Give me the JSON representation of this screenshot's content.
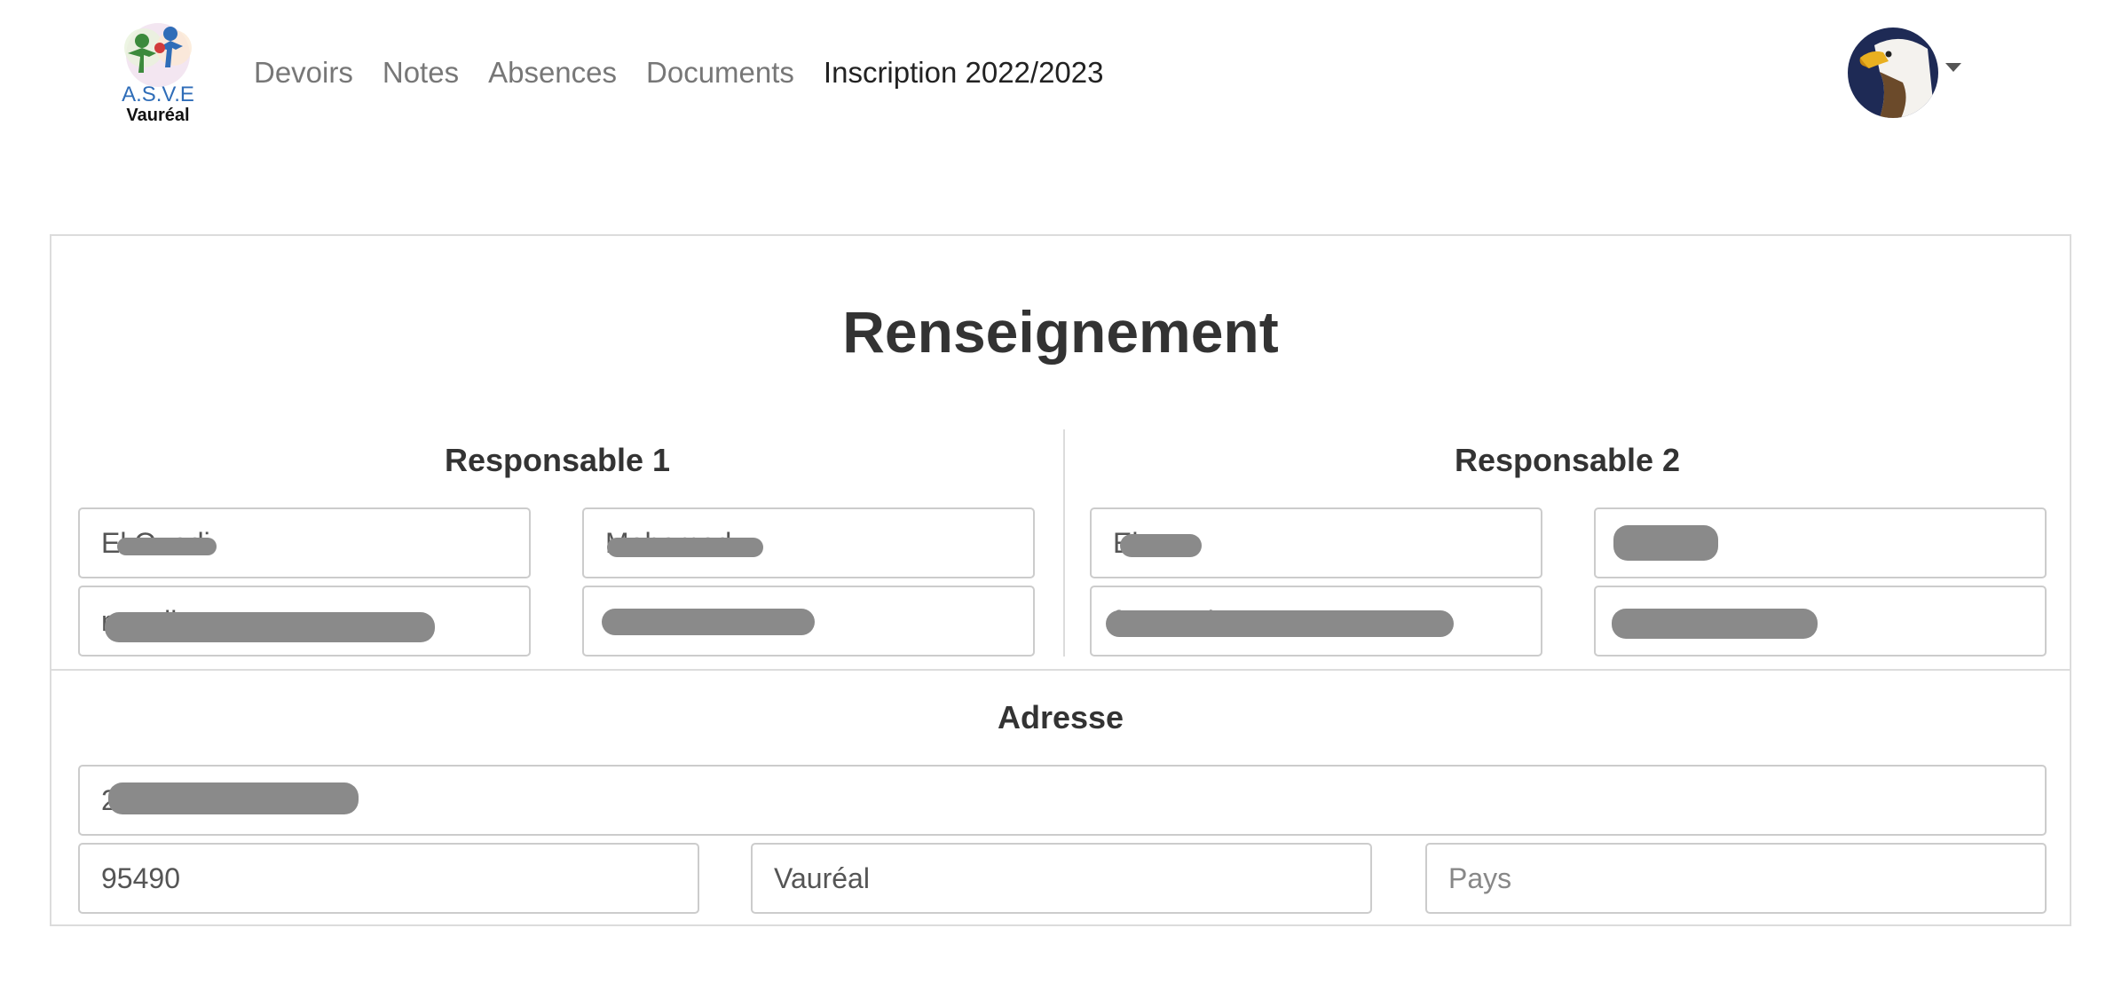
{
  "nav": {
    "items": [
      "Devoirs",
      "Notes",
      "Absences",
      "Documents",
      "Inscription 2022/2023"
    ],
    "active_index": 4
  },
  "logo": {
    "text_line1": "A.S.V.E",
    "text_line2": "Vauréal"
  },
  "panel": {
    "title": "Renseignement",
    "responsable1": {
      "heading": "Responsable 1",
      "nom": "El Ouadi",
      "prenom": "Mohamed",
      "email": "m.....il.com",
      "telephone": "+... 04 1288 429"
    },
    "responsable2": {
      "heading": "Responsable 2",
      "nom": "El.....n",
      "prenom": "",
      "email": "f....g.....l.",
      "telephone": "06.......2"
    },
    "adresse": {
      "heading": "Adresse",
      "rue": "27 R.....",
      "code_postal": "95490",
      "ville": "Vauréal",
      "pays_placeholder": "Pays"
    }
  },
  "colors": {
    "accent_text": "#333333",
    "nav_muted": "#777777",
    "border": "#cccccc",
    "redaction": "#8a8a8a"
  }
}
